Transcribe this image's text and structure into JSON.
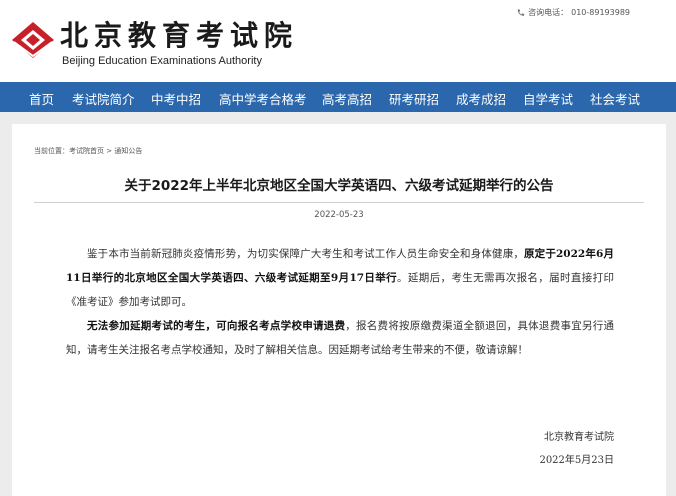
{
  "header": {
    "logo_cn": "北京教育考试院",
    "logo_en": "Beijing Education Examinations Authority",
    "logo_icon": "diamond-logo-icon",
    "phone_icon": "phone-icon",
    "phone_label": "咨询电话：",
    "phone_number": "010-89193989"
  },
  "nav": {
    "items": [
      {
        "label": "首页"
      },
      {
        "label": "考试院简介"
      },
      {
        "label": "中考中招"
      },
      {
        "label": "高中学考合格考"
      },
      {
        "label": "高考高招"
      },
      {
        "label": "研考研招"
      },
      {
        "label": "成考成招"
      },
      {
        "label": "自学考试"
      },
      {
        "label": "社会考试"
      }
    ],
    "color": "#2a67ad"
  },
  "breadcrumb": {
    "prefix": "当前位置：",
    "home": "考试院首页",
    "sep": " > ",
    "current": "通知公告"
  },
  "article": {
    "title": "关于2022年上半年北京地区全国大学英语四、六级考试延期举行的公告",
    "date": "2022-05-23",
    "p1_a": "鉴于本市当前新冠肺炎疫情形势，为切实保障广大考生和考试工作人员生命安全和身体健康，",
    "p1_b": "原定于2022年6月11日举行的北京地区全国大学英语四、六级考试延期至9月17日举行",
    "p1_c": "。延期后，考生无需再次报名，届时直接打印《准考证》参加考试即可。",
    "p2_a": "无法参加延期考试的考生，可向报名考点学校申请退费",
    "p2_b": "，报名费将按原缴费渠道全额退回，具体退费事宜另行通知，请考生关注报名考点学校通知，及时了解相关信息。因延期考试给考生带来的不便，敬请谅解！",
    "sign_org": "北京教育考试院",
    "sign_date": "2022年5月23日"
  }
}
